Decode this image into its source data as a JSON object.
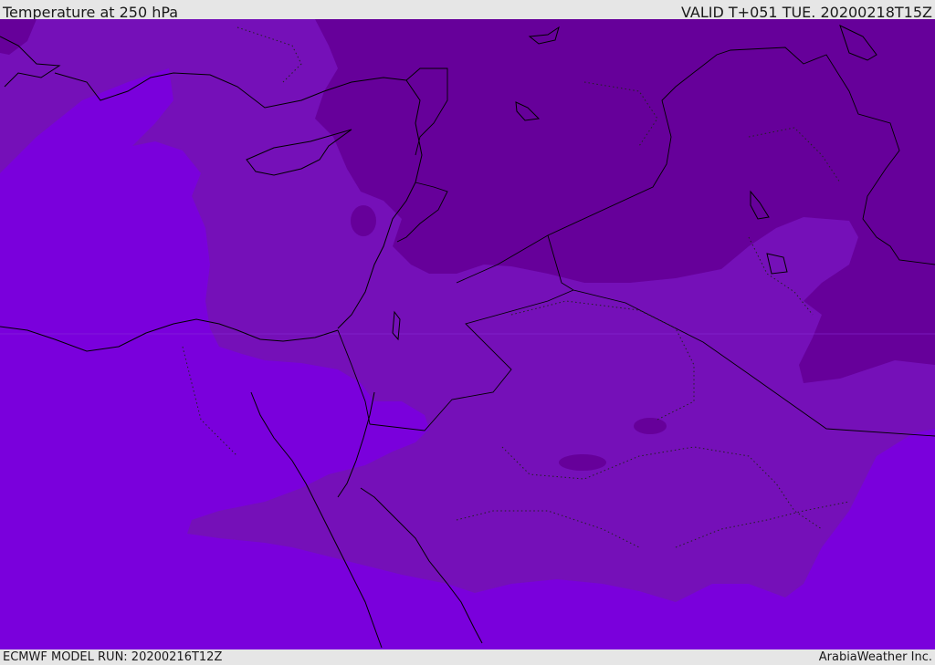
{
  "header": {
    "title": "Temperature at 250 hPa",
    "valid": "VALID T+051 TUE. 20200218T15Z"
  },
  "footer": {
    "model_run": "ECMWF MODEL RUN: 20200216T12Z",
    "credit": "ArabiaWeather Inc."
  },
  "map": {
    "field": "temperature",
    "level": "250 hPa",
    "colors": {
      "warmest_band": "#7a00dc",
      "middle_band": "#7510b8",
      "coldest_band": "#66009a",
      "coastline": "#000000"
    }
  }
}
